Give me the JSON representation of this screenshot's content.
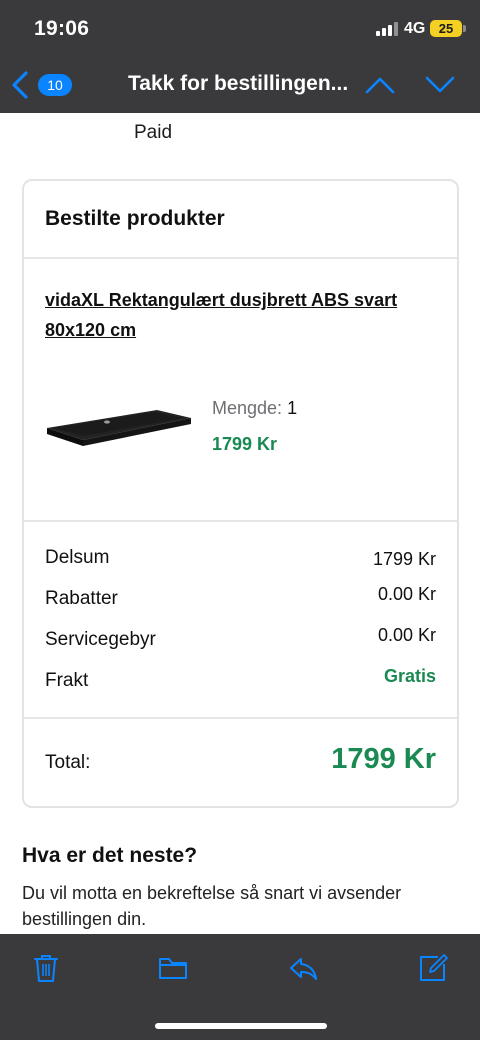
{
  "status_bar": {
    "time": "19:06",
    "network": "4G",
    "battery": "25"
  },
  "nav": {
    "badge_count": "10",
    "title": "Takk for bestillingen...",
    "icons": [
      "chevron-left-icon",
      "chevron-up-icon",
      "chevron-down-icon"
    ]
  },
  "email": {
    "payment_status": "Paid",
    "order_card": {
      "title": "Bestilte produkter",
      "product": {
        "name": "vidaXL Rektangulært dusjbrett ABS svart 80x120 cm",
        "quantity_label": "Mengde:",
        "quantity_value": "1",
        "price": "1799 Kr"
      },
      "summary": [
        {
          "label": "Delsum",
          "value": "1799 Kr"
        },
        {
          "label": "Rabatter",
          "value": "0.00 Kr"
        },
        {
          "label": "Servicegebyr",
          "value": "0.00 Kr"
        },
        {
          "label": "Frakt",
          "value": "Gratis"
        }
      ],
      "total_label": "Total:",
      "total_value": "1799 Kr"
    },
    "next": {
      "title": "Hva er det neste?",
      "text": "Du vil motta en bekreftelse så snart vi avsender bestillingen din."
    }
  },
  "toolbar": {
    "icons": [
      "trash-icon",
      "folder-icon",
      "reply-icon",
      "compose-icon"
    ]
  },
  "colors": {
    "accent_blue": "#0a84ff",
    "price_green": "#1a8a52",
    "chrome_dark": "#3a3a3c",
    "battery_yellow": "#f2d024"
  }
}
